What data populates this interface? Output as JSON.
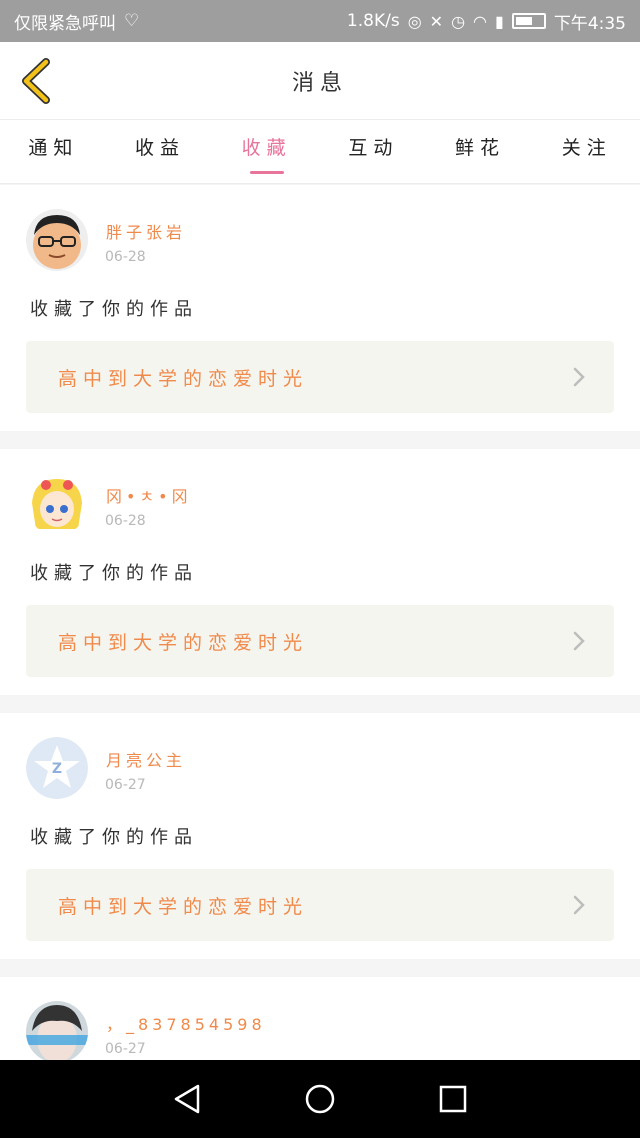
{
  "status_bar": {
    "carrier": "仅限紧急呼叫",
    "speed": "1.8K/s",
    "time": "下午4:35",
    "icons": [
      "heart-monitor-icon",
      "data-saver-icon",
      "mute-icon",
      "alarm-icon",
      "wifi-icon",
      "signal-icon",
      "battery-icon"
    ]
  },
  "header": {
    "title": "消息",
    "back_icon": "chevron-left-icon"
  },
  "tabs": [
    {
      "label": "通知",
      "active": false
    },
    {
      "label": "收益",
      "active": false
    },
    {
      "label": "收藏",
      "active": true
    },
    {
      "label": "互动",
      "active": false
    },
    {
      "label": "鲜花",
      "active": false
    },
    {
      "label": "关注",
      "active": false
    }
  ],
  "messages": [
    {
      "user": "胖子张岩",
      "date": "06-28",
      "action": "收藏了你的作品",
      "work": "高中到大学的恋爱时光",
      "avatar": "avatar-cartoon-man"
    },
    {
      "user": "冈•ㅊ•冈",
      "date": "06-28",
      "action": "收藏了你的作品",
      "work": "高中到大学的恋爱时光",
      "avatar": "avatar-anime-girl"
    },
    {
      "user": "月亮公主",
      "date": "06-27",
      "action": "收藏了你的作品",
      "work": "高中到大学的恋爱时光",
      "avatar": "avatar-default-star"
    },
    {
      "user": "，_837854598",
      "date": "06-27",
      "action": "",
      "work": "",
      "avatar": "avatar-photo"
    }
  ],
  "colors": {
    "accent": "#e8749a",
    "username": "#f08a4b",
    "back_arrow": "#f2c21a",
    "status_bar": "#9e9e9e"
  }
}
